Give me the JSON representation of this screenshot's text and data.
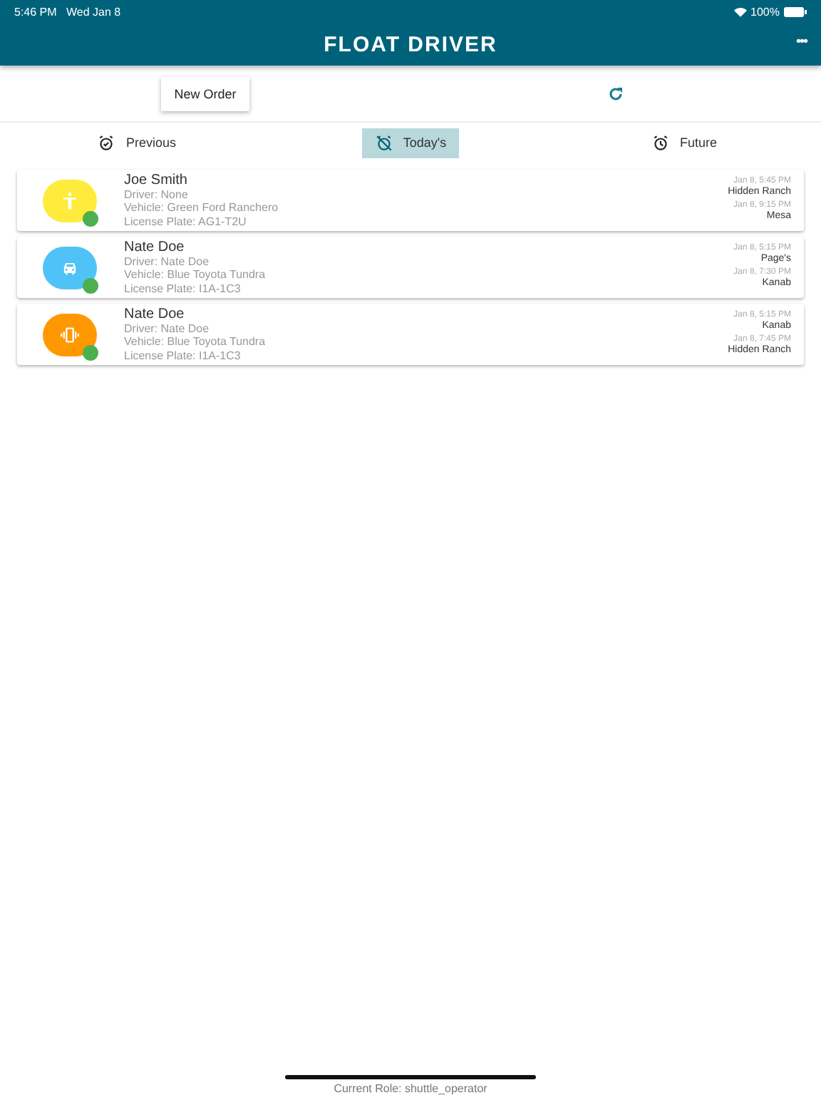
{
  "status_bar": {
    "time": "5:46 PM",
    "date": "Wed Jan 8",
    "battery": "100%"
  },
  "header": {
    "title": "FLOAT DRIVER",
    "menu": "•••"
  },
  "toolbar": {
    "new_order": "New Order"
  },
  "tabs": [
    {
      "label": "Previous",
      "kind": "past",
      "selected": false
    },
    {
      "label": "Today's",
      "kind": "today",
      "selected": true
    },
    {
      "label": "Future",
      "kind": "future",
      "selected": false
    }
  ],
  "orders": [
    {
      "kind": "person",
      "color": "#ffeb3b",
      "name": "Joe Smith",
      "driver": "Driver: None",
      "vehicle": "Vehicle: Green Ford Ranchero",
      "plate": "License Plate: AG1-T2U",
      "pickup_time": "Jan 8, 5:45 PM",
      "pickup": "Hidden Ranch",
      "dropoff_time": "Jan 8, 9:15 PM",
      "dropoff": "Mesa"
    },
    {
      "kind": "car",
      "color": "#4fc3f7",
      "name": "Nate Doe",
      "driver": "Driver: Nate Doe",
      "vehicle": "Vehicle: Blue Toyota Tundra",
      "plate": "License Plate: I1A-1C3",
      "pickup_time": "Jan 8, 5:15 PM",
      "pickup": "Page's",
      "dropoff_time": "Jan 8, 7:30 PM",
      "dropoff": "Kanab"
    },
    {
      "kind": "vibrate",
      "color": "#ff9800",
      "name": "Nate Doe",
      "driver": "Driver: Nate Doe",
      "vehicle": "Vehicle: Blue Toyota Tundra",
      "plate": "License Plate: I1A-1C3",
      "pickup_time": "Jan 8, 5:15 PM",
      "pickup": "Kanab",
      "dropoff_time": "Jan 8, 7:45 PM",
      "dropoff": "Hidden Ranch"
    }
  ],
  "footer": {
    "role": "Current Role: shuttle_operator"
  }
}
